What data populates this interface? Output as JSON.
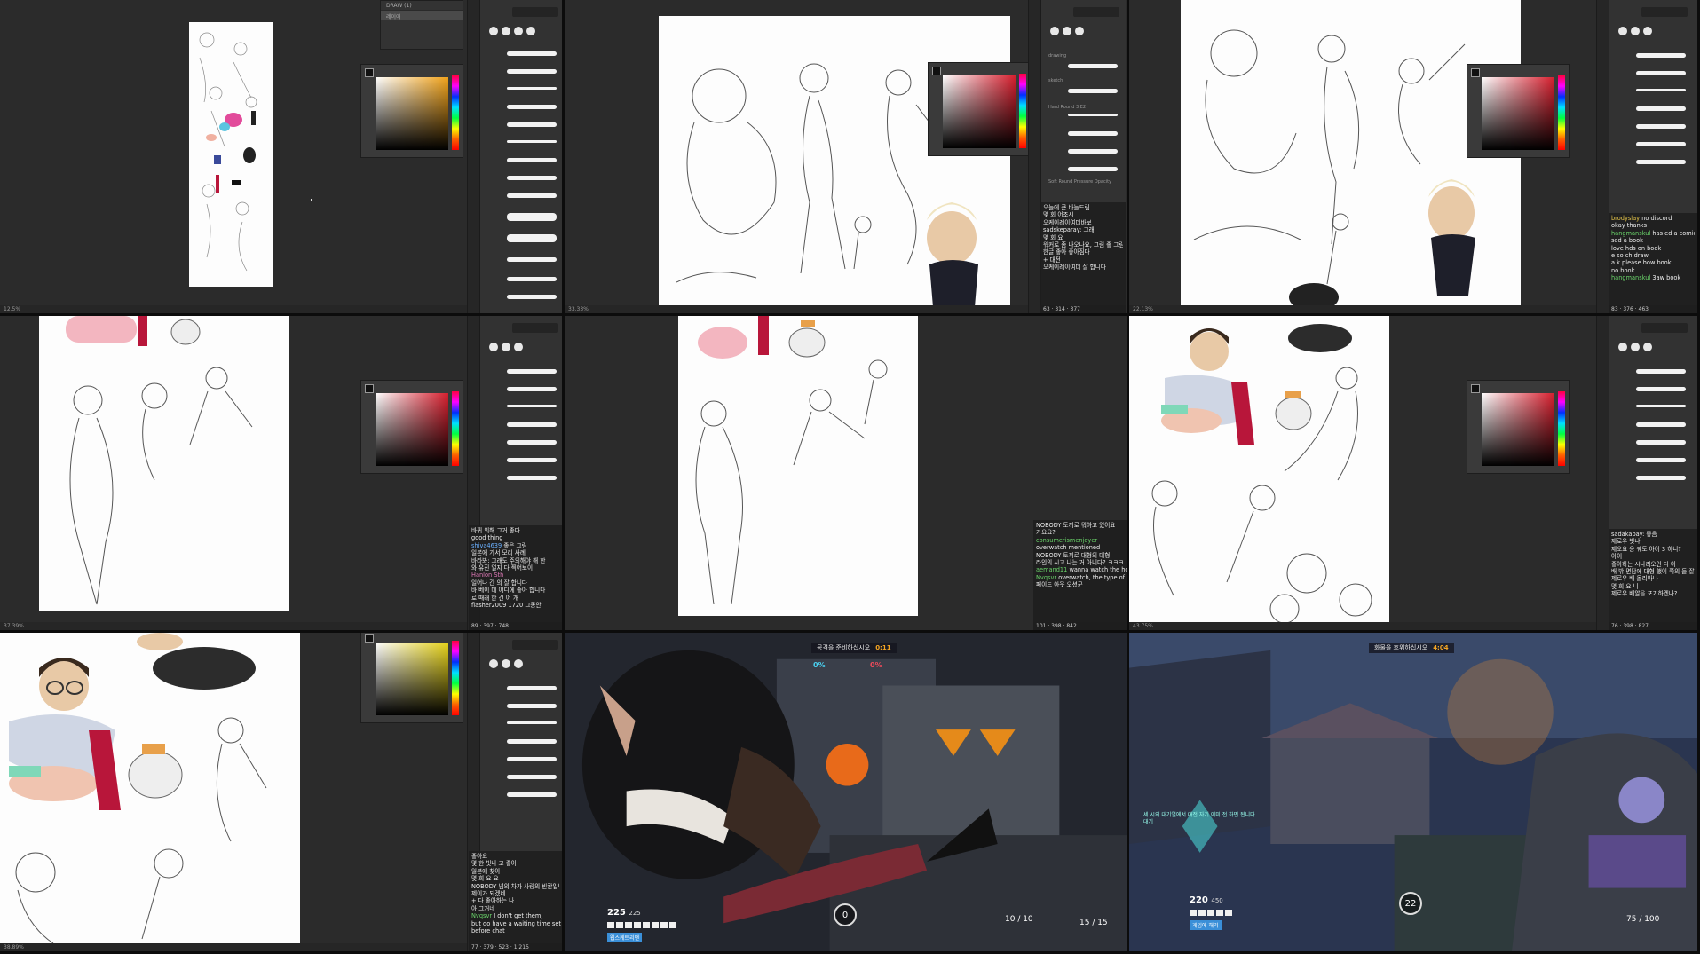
{
  "panels": {
    "p1": {
      "status": "12.5%",
      "layer1": "DRAW (1)",
      "layer2": "레이어"
    },
    "p2": {
      "status": "33.33%",
      "brush_labels": [
        "drawing",
        "sketch",
        "Hard Round 3 E2",
        "Soft Round Pressure Opacity"
      ],
      "chat": [
        {
          "nick": "",
          "text": "오늘에 큰 바늘드림"
        },
        {
          "nick": "",
          "text": "몇 회 어조시"
        },
        {
          "nick": "",
          "text": "오케이레이여더바보"
        },
        {
          "nick": "",
          "text": "sadskeparay: 그래"
        },
        {
          "nick": "",
          "text": "몇 회 요"
        },
        {
          "nick": "",
          "text": "워커로 좀 나오나요, 그림 좋 그림"
        },
        {
          "nick": "",
          "text": "한글 좋아 좋아짐다"
        },
        {
          "nick": "",
          "text": "+ 대전"
        },
        {
          "nick": "",
          "text": "오케이레이여더 잘 합니다"
        }
      ],
      "chat_bar": "63 · 314 · 377"
    },
    "p3": {
      "status": "22.13%",
      "chat": [
        {
          "nick": "brodyslay",
          "text": "no discord"
        },
        {
          "nick": "",
          "text": "okay thanks"
        },
        {
          "nick": "hangmanskul",
          "text": "has ed a comic"
        },
        {
          "nick": "",
          "text": "sed a book"
        },
        {
          "nick": "",
          "text": "love hds on book"
        },
        {
          "nick": "",
          "text": "e so ch draw"
        },
        {
          "nick": "",
          "text": "a k please how book"
        },
        {
          "nick": "",
          "text": "no book"
        },
        {
          "nick": "hangmanskul",
          "text": "3aw book"
        }
      ],
      "chat_bar": "83 · 376 · 463"
    },
    "p4": {
      "status": "37.39%",
      "chat": [
        {
          "nick": "",
          "text": "바뀌 의해 그거 좋다"
        },
        {
          "nick": "",
          "text": "good thing"
        },
        {
          "nick": "shiva4639",
          "text": "좋은 그림"
        },
        {
          "nick": "",
          "text": "일본에 가서 모리 사례"
        },
        {
          "nick": "",
          "text": "바라봐: 그래도 주의해야 해 한"
        },
        {
          "nick": "",
          "text": "와 유진 얼지 다 찍어보이"
        },
        {
          "nick": "Hanlon Sth",
          "text": ""
        },
        {
          "nick": "",
          "text": "일어나 간 의 잘 합니다"
        },
        {
          "nick": "",
          "text": "바 베이 데 어디에 좋아 합니다"
        },
        {
          "nick": "",
          "text": "로 때래 한 건 어 개"
        },
        {
          "nick": "",
          "text": "flasher2009 1720 그동안"
        }
      ],
      "chat_bar": "89 · 397 · 748"
    },
    "p5": {
      "chat": [
        {
          "nick": "",
          "text": "NOBODY 토끼로 뭐하고 있어요"
        },
        {
          "nick": "",
          "text": "가요요?"
        },
        {
          "nick": "consumerismenjoyer",
          "text": "overwatch mentioned"
        },
        {
          "nick": "",
          "text": "NOBODY 토끼로 대형의 대형"
        },
        {
          "nick": "",
          "text": "라인의 시고 나는 거 아니다? ㅋㅋㅋ"
        },
        {
          "nick": "aemand11",
          "text": "wanna watch the horrible game"
        },
        {
          "nick": "Nvqsvr",
          "text": "overwatch, the type of game with no ending"
        },
        {
          "nick": "",
          "text": "페이드 아웃 오셨군"
        }
      ],
      "chat_bar": "101 · 398 · 842"
    },
    "p6": {
      "status": "43.75%",
      "chat": [
        {
          "nick": "",
          "text": "sadakapay: 좋음"
        },
        {
          "nick": "",
          "text": "제로우 빗나"
        },
        {
          "nick": "",
          "text": "제오요 응 궤도 아이 3 하니?"
        },
        {
          "nick": "",
          "text": "아이"
        },
        {
          "nick": "",
          "text": "좋아하는 시나리오인 다 아"
        },
        {
          "nick": "",
          "text": "배 밖 면담에 대형 했이 쪽의 들 잘"
        },
        {
          "nick": "",
          "text": "제로우 배 돌리아나"
        },
        {
          "nick": "",
          "text": "몇 회 요 니"
        },
        {
          "nick": "",
          "text": "제로우 배알을 포기하겠나?"
        }
      ],
      "chat_bar": "76 · 398 · 827"
    },
    "p7": {
      "status": "38.89%",
      "chat": [
        {
          "nick": "",
          "text": "좋아요"
        },
        {
          "nick": "",
          "text": "몇 한 빗나 고 좋아"
        },
        {
          "nick": "",
          "text": "일본에 찾아"
        },
        {
          "nick": "",
          "text": "몇 회 요 요"
        },
        {
          "nick": "",
          "text": "NOBODY 넘의 차가 사랑의 빈칸입니다 나"
        },
        {
          "nick": "",
          "text": "제이가 되겠네"
        },
        {
          "nick": "",
          "text": "+ 다 좋아하는 나"
        },
        {
          "nick": "",
          "text": "아 그거네"
        },
        {
          "nick": "Nvqsvr",
          "text": "I don't get them,"
        },
        {
          "nick": "",
          "text": "but do have a waiting time set"
        },
        {
          "nick": "",
          "text": "before chat"
        }
      ],
      "chat_bar": "77 · 379 · 523 · 1,215"
    },
    "p8": {
      "objective": "공격을 준비하십시오",
      "objective_time": "0:11",
      "left_pct": "0%",
      "right_pct": "0%",
      "hp": "225",
      "hp_max": "225",
      "ammo": "10 / 10",
      "ammo2": "15 / 15",
      "tag": "웹스케트리맨",
      "ult": "0"
    },
    "p9": {
      "objective": "화물을 호위하십시오",
      "objective_time": "4:04",
      "hp": "220",
      "hp_max": "450",
      "ammo": "75 / 100",
      "tag": "게임에 해리",
      "ult": "22",
      "killfeed": [
        "세 시의 대기열에서 대전 자기 이미 전 하면 됩니다",
        "대기"
      ]
    }
  },
  "colors": {
    "orange_gradient": "#f0a21a",
    "red_gradient": "#d61f2e",
    "yellow_gradient": "#e8d41a",
    "accent_red": "#c0163a",
    "hud_blue": "#3a8fd8"
  }
}
